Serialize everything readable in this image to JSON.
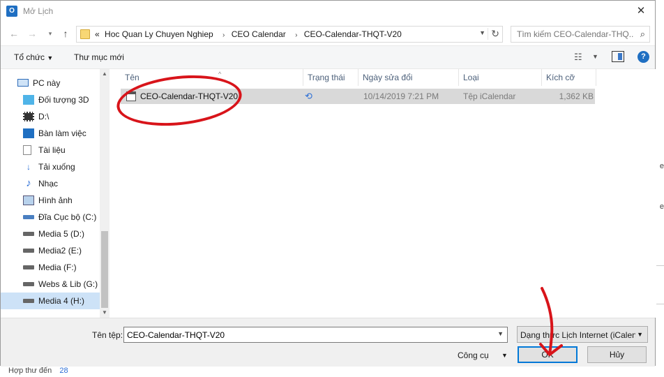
{
  "window": {
    "title": "Mở Lịch"
  },
  "address": {
    "overflow": "«",
    "crumbs": [
      "Hoc Quan Ly Chuyen Nghiep",
      "CEO Calendar",
      "CEO-Calendar-THQT-V20"
    ],
    "separator": "›"
  },
  "search": {
    "placeholder": "Tìm kiếm CEO-Calendar-THQ..."
  },
  "toolbar": {
    "organize": "Tổ chức",
    "new_folder": "Thư mục mới",
    "help": "?"
  },
  "sidebar": {
    "items": [
      {
        "label": "PC này",
        "icon": "computer-icon"
      },
      {
        "label": "Đối tượng 3D",
        "icon": "cube-icon"
      },
      {
        "label": "D:\\",
        "icon": "film-icon"
      },
      {
        "label": "Bàn làm việc",
        "icon": "desktop-icon"
      },
      {
        "label": "Tài liệu",
        "icon": "document-icon"
      },
      {
        "label": "Tải xuống",
        "icon": "download-icon"
      },
      {
        "label": "Nhạc",
        "icon": "music-icon"
      },
      {
        "label": "Hình ảnh",
        "icon": "picture-icon"
      },
      {
        "label": "Đĩa Cục bộ (C:)",
        "icon": "drive-icon"
      },
      {
        "label": "Media 5 (D:)",
        "icon": "drive-icon"
      },
      {
        "label": "Media2 (E:)",
        "icon": "drive-icon"
      },
      {
        "label": "Media (F:)",
        "icon": "drive-icon"
      },
      {
        "label": "Webs & Lib (G:)",
        "icon": "drive-icon"
      },
      {
        "label": "Media 4 (H:)",
        "icon": "drive-icon"
      }
    ]
  },
  "columns": {
    "name": "Tên",
    "status": "Trạng thái",
    "modified": "Ngày sửa đổi",
    "type": "Loại",
    "size": "Kích cỡ"
  },
  "files": [
    {
      "name": "CEO-Calendar-THQT-V20",
      "modified": "10/14/2019 7:21 PM",
      "type": "Tệp iCalendar",
      "size": "1,362 KB"
    }
  ],
  "footer": {
    "filename_label": "Tên tệp:",
    "filename_value": "CEO-Calendar-THQT-V20",
    "filetype": "Dạng thức Lịch Internet (iCalen",
    "tools": "Công cụ",
    "ok": "OK",
    "cancel": "Hủy"
  },
  "background": {
    "bottom_text": "Hợp thư đến",
    "bottom_number": "28"
  },
  "colors": {
    "accent": "#0078d7",
    "annotation": "#d8141a",
    "selection": "#cde2f7"
  }
}
